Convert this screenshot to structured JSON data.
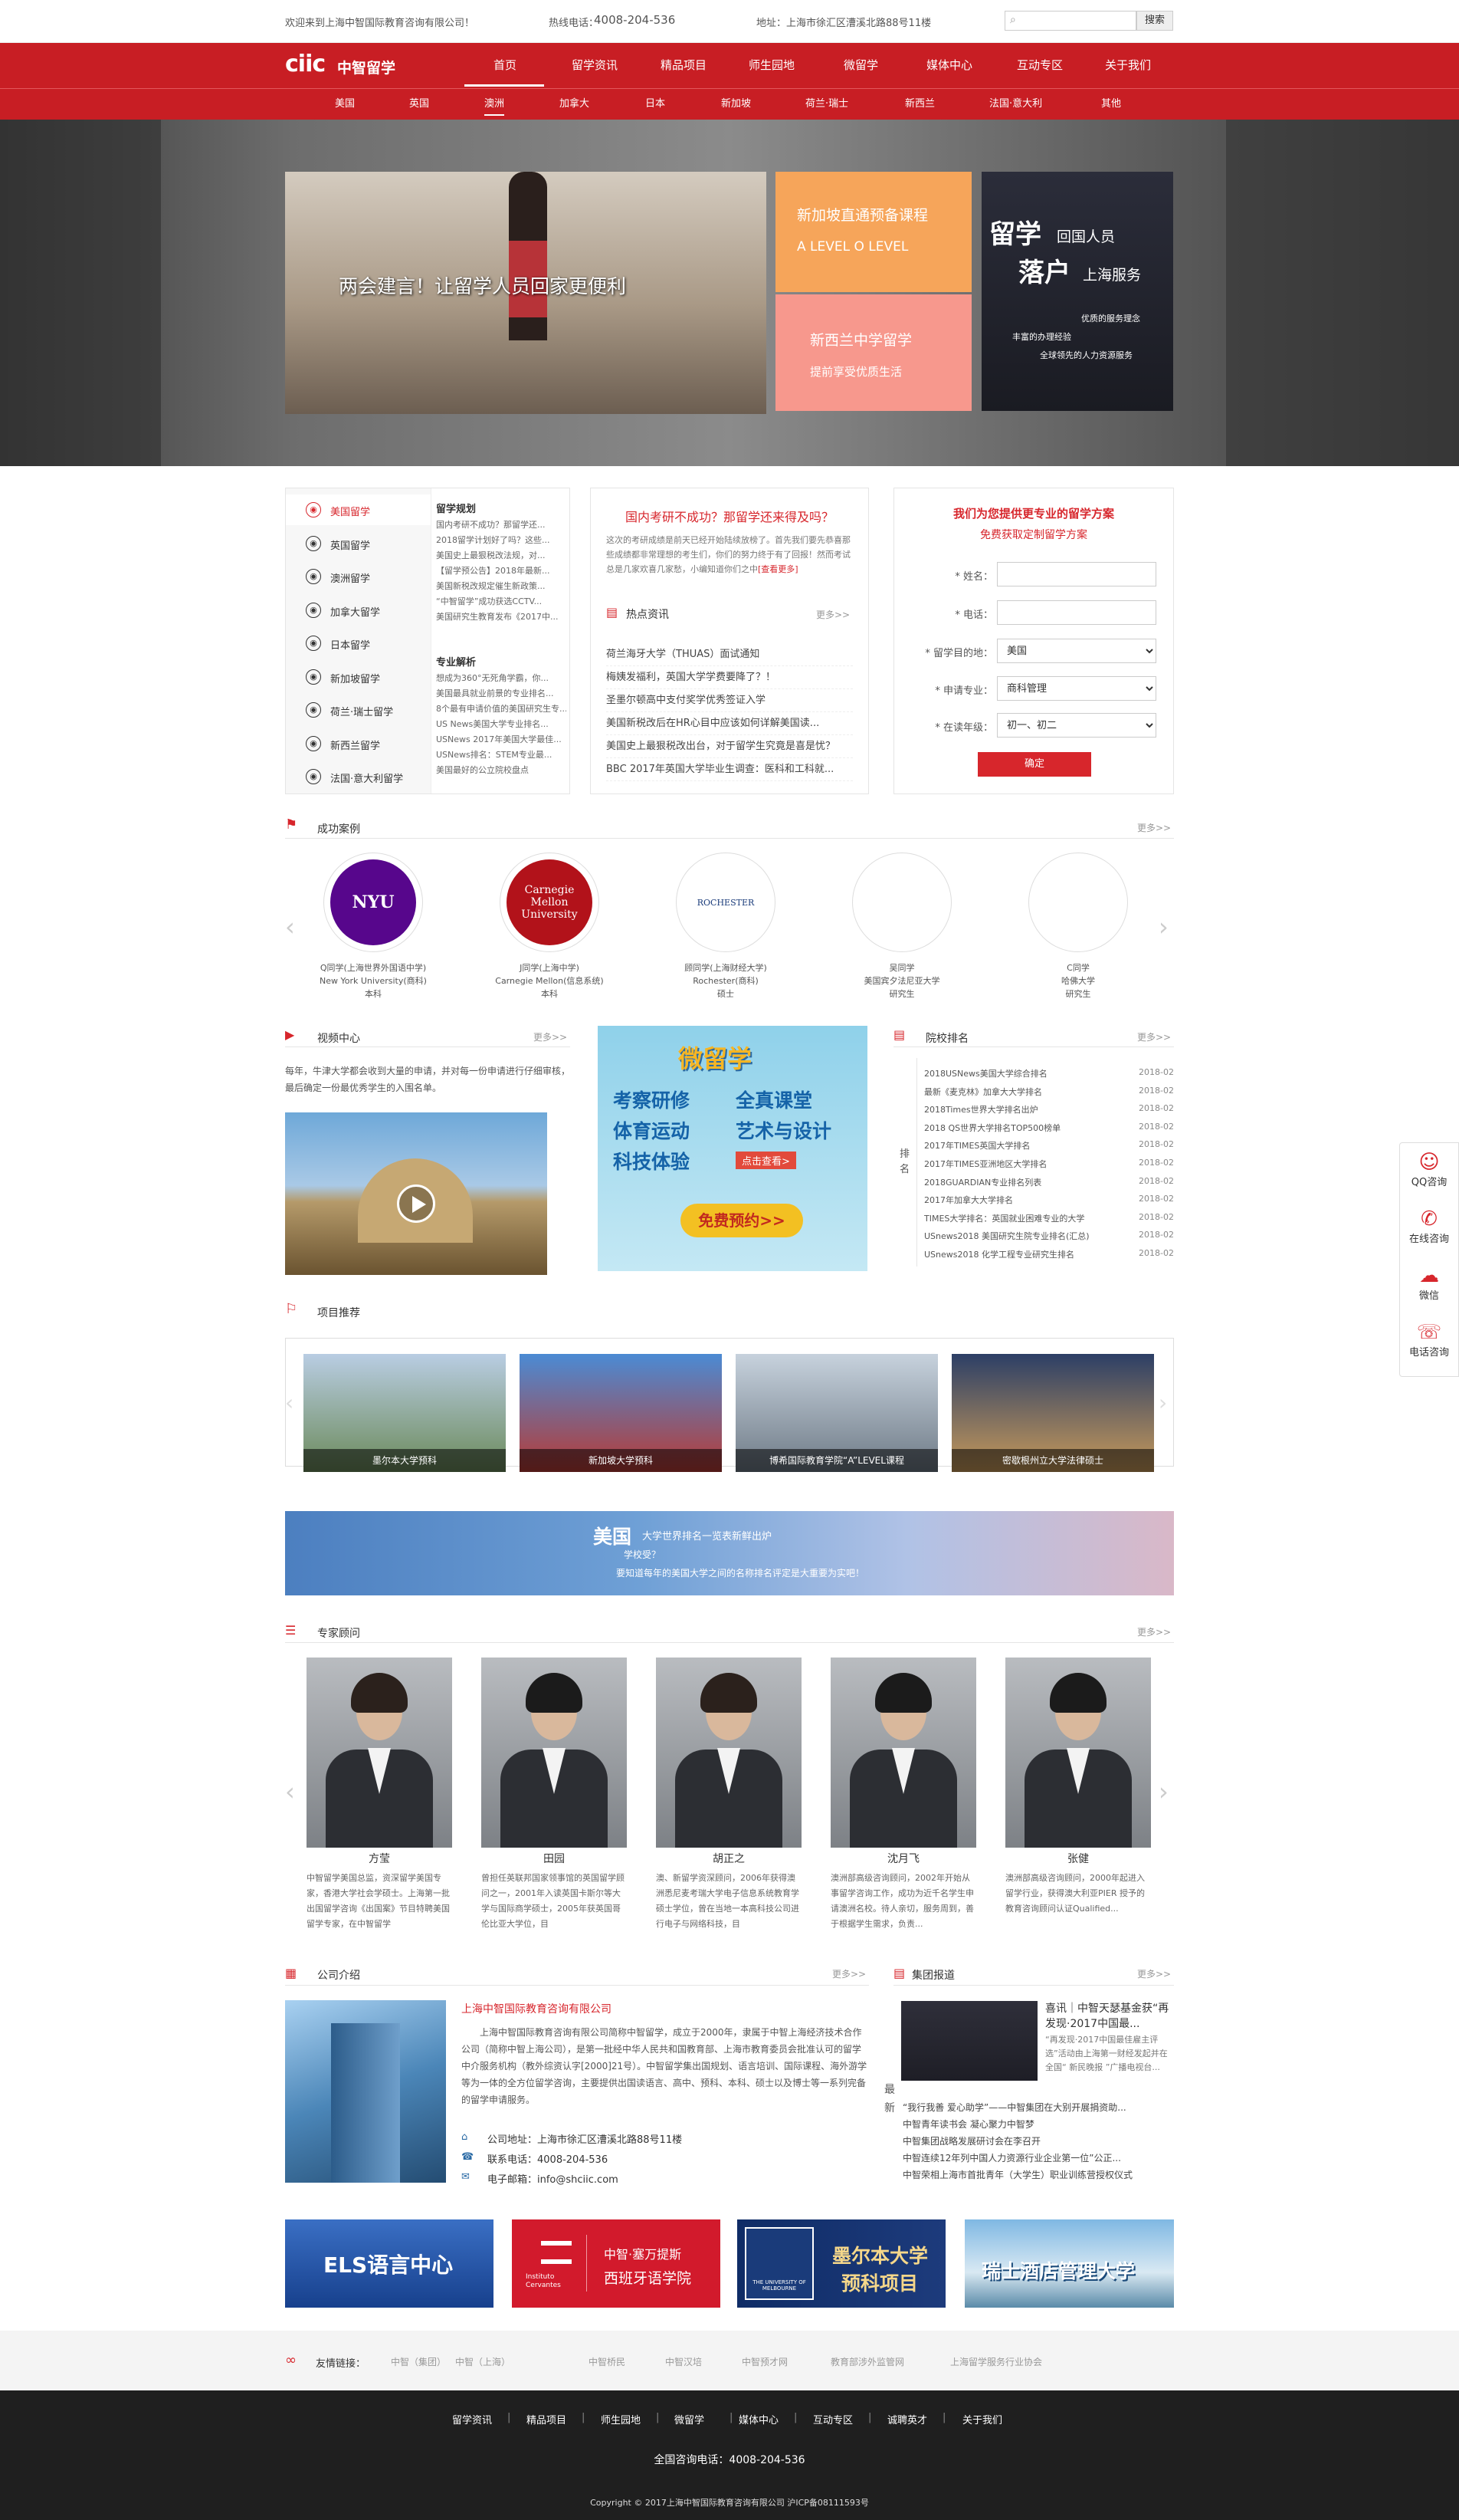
{
  "topbar": {
    "welcome": "欢迎来到上海中智国际教育咨询有限公司！",
    "hotline_label": "热线电话：",
    "hotline": "4008-204-536",
    "address": "地址：上海市徐汇区漕溪北路88号11楼",
    "search_btn": "搜索"
  },
  "brand": {
    "logo": "ciic",
    "logo_cn": "中智留学"
  },
  "nav": [
    "首页",
    "留学资讯",
    "精品项目",
    "师生园地",
    "微留学",
    "媒体中心",
    "互动专区",
    "关于我们"
  ],
  "subnav": [
    "美国",
    "英国",
    "澳洲",
    "加拿大",
    "日本",
    "新加坡",
    "荷兰·瑞士",
    "新西兰",
    "法国·意大利",
    "其他"
  ],
  "hero": {
    "main_caption": "两会建言！让留学人员回家更便利",
    "card1_title": "新加坡直通预备课程",
    "card1_sub": "A LEVEL    O LEVEL",
    "card2_title": "新西兰中学留学",
    "card2_sub": "提前享受优质生活",
    "card3_big1": "留学",
    "card3_small1": "回国人员",
    "card3_big2": "落户",
    "card3_small2": "上海服务",
    "card3_l1": "优质的服务理念",
    "card3_l2": "丰富的办理经验",
    "card3_l3": "全球领先的人力资源服务"
  },
  "country_menu": [
    "美国留学",
    "英国留学",
    "澳洲留学",
    "加拿大留学",
    "日本留学",
    "新加坡留学",
    "荷兰·瑞士留学",
    "新西兰留学",
    "法国·意大利留学"
  ],
  "plan": {
    "title": "留学规划",
    "items": [
      "国内考研不成功？那留学还...",
      "2018留学计划好了吗？这些...",
      "美国史上最狠税改法规，对...",
      "【留学预公告】2018年最新...",
      "美国新税改规定催生新政策...",
      "“中智留学”成功获选CCTV...",
      "美国研究生教育发布《2017中..."
    ]
  },
  "major": {
    "title": "专业解析",
    "items": [
      "想成为360°无死角学霸，你...",
      "美国最具就业前景的专业排名...",
      "8个最有申请价值的美国研究生专...",
      "US News美国大学专业排名...",
      "USNews 2017年美国大学最佳...",
      "USNews排名：STEM专业最...",
      "美国最好的公立院校盘点"
    ]
  },
  "news": {
    "headline": "国内考研不成功？那留学还来得及吗？",
    "summary": "这次的考研成绩是前天已经开始陆续放榜了。首先我们要先恭喜那些成绩都非常理想的考生们，你们的努力终于有了回报！然而考试总是几家欢喜几家愁，小编知道你们之中",
    "read_more": "[查看更多]",
    "section": "热点资讯",
    "more": "更多>>",
    "items": [
      "荷兰海牙大学（THUAS）面试通知",
      "梅姨发福利，英国大学学费要降了？！",
      "圣墨尔顿高中支付奖学优秀签证入学",
      "美国新税改后在HR心目中应该如何详解美国读...",
      "美国史上最狠税改出台，对于留学生究竟是喜是忧？",
      "BBC 2017年英国大学毕业生调查：医科和工科就..."
    ]
  },
  "form": {
    "title": "我们为您提供更专业的留学方案",
    "subtitle": "免费获取定制留学方案",
    "name_label": "* 姓名：",
    "phone_label": "* 电话：",
    "dest_label": "* 留学目的地：",
    "dest_value": "美国",
    "major_label": "* 申请专业：",
    "major_value": "商科管理",
    "grade_label": "* 在读年级：",
    "grade_value": "初一、初二",
    "submit": "确定"
  },
  "cases": {
    "title": "成功案例",
    "more": "更多>>",
    "items": [
      {
        "logo": "NYU",
        "name": "Q同学(上海世界外国语中学)",
        "school": "New York University(商科)",
        "degree": "本科"
      },
      {
        "logo": "Carnegie Mellon University",
        "name": "J同学(上海中学)",
        "school": "Carnegie Mellon(信息系统)",
        "degree": "本科"
      },
      {
        "logo": "ROCHESTER",
        "name": "顾同学(上海财经大学)",
        "school": "Rochester(商科)",
        "degree": "硕士"
      },
      {
        "logo": "",
        "name": "吴同学",
        "school": "美国宾夕法尼亚大学",
        "degree": "研究生"
      },
      {
        "logo": "",
        "name": "C同学",
        "school": "哈佛大学",
        "degree": "研究生"
      }
    ]
  },
  "video": {
    "title": "视频中心",
    "more": "更多>>",
    "desc": "每年，牛津大学都会收到大量的申请，并对每一份申请进行仔细审核，最后确定一份最优秀学生的入围名单。"
  },
  "micro": {
    "title": "微留学",
    "row1a": "考察研修",
    "row1b": "全真课堂",
    "row2a": "体育运动",
    "row2b": "艺术与设计",
    "row3": "科技体验",
    "row3tag": "点击查看>",
    "cta": "免费预约>>"
  },
  "ranking": {
    "title": "院校排名",
    "more": "更多>>",
    "side": "排名",
    "items": [
      {
        "t": "2018USNews美国大学综合排名",
        "d": "2018-02"
      },
      {
        "t": "最新《麦克林》加拿大大学排名",
        "d": "2018-02"
      },
      {
        "t": "2018Times世界大学排名出炉",
        "d": "2018-02"
      },
      {
        "t": "2018 QS世界大学排名TOP500榜单",
        "d": "2018-02"
      },
      {
        "t": "2017年TIMES英国大学排名",
        "d": "2018-02"
      },
      {
        "t": "2017年TIMES亚洲地区大学排名",
        "d": "2018-02"
      },
      {
        "t": "2018GUARDIAN专业排名列表",
        "d": "2018-02"
      },
      {
        "t": "2017年加拿大大学排名",
        "d": "2018-02"
      },
      {
        "t": "TIMES大学排名：英国就业困难专业的大学",
        "d": "2018-02"
      },
      {
        "t": "USnews2018 美国研究生院专业排名(汇总)",
        "d": "2018-02"
      },
      {
        "t": "USnews2018 化学工程专业研究生排名",
        "d": "2018-02"
      }
    ]
  },
  "projects": {
    "title": "项目推荐",
    "items": [
      "墨尔本大学预科",
      "新加坡大学预科",
      "博希国际教育学院“A”LEVEL课程",
      "密歇根州立大学法律硕士"
    ]
  },
  "promo": {
    "big": "美国",
    "l1": "大学世界排名一览表新鲜出炉",
    "l2": "学校受？",
    "l3": "要知道每年的美国大学之间的名称排名评定是大重要为实吧！"
  },
  "experts": {
    "title": "专家顾问",
    "more": "更多>>",
    "items": [
      {
        "name": "方莹",
        "desc": "中智留学美国总监，资深留学美国专家，香港大学社会学硕士。上海第一批出国留学咨询《出国案》节目特聘美国留学专家，在中智留学"
      },
      {
        "name": "田园",
        "desc": "曾担任英联邦国家领事馆的英国留学顾问之一，2001年入读英国卡斯尔等大学与国际商学硕士，2005年获英国哥伦比亚大学位，目"
      },
      {
        "name": "胡正之",
        "desc": "澳、新留学资深顾问，2006年获得澳洲悉尼麦考瑞大学电子信息系统教育学硕士学位，曾在当地一本高科技公司进行电子与网络科技，目"
      },
      {
        "name": "沈月飞",
        "desc": "澳洲部高级咨询顾问，2002年开始从事留学咨询工作，成功为近千名学生申请澳洲名校。待人亲切，服务周到，善于根据学生需求，负责..."
      },
      {
        "name": "张健",
        "desc": "澳洲部高级咨询顾问，2000年起进入留学行业，获得澳大利亚PIER 授予的教育咨询顾问认证Qualified..."
      }
    ]
  },
  "about": {
    "title": "公司介绍",
    "more": "更多>>",
    "company": "上海中智国际教育咨询有限公司",
    "text": "上海中智国际教育咨询有限公司简称中智留学，成立于2000年，隶属于中智上海经济技术合作公司（简称中智上海公司），是第一批经中华人民共和国教育部、上海市教育委员会批准认可的留学中介服务机构（教外综资认字[2000]21号）。中智留学集出国规划、语言培训、国际课程、海外游学等为一体的全方位留学咨询，主要提供出国读语言、高中、预科、本科、硕士以及博士等一系列完备的留学申请服务。",
    "addr": "公司地址：上海市徐汇区漕溪北路88号11楼",
    "phone": "联系电话：4008-204-536",
    "email": "电子邮箱：info@shciic.com"
  },
  "group": {
    "title": "集团报道",
    "more": "更多>>",
    "side": "最新",
    "headline": "喜讯｜中智天瑟基金获“再发现·2017中国最...",
    "summary": "“再发现·2017中国最佳雇主评选”活动由上海第一财经发起并在全国“ 新民晚报 ”广播电视台...",
    "items": [
      "“我行我善 爱心助学”——中智集团在大别开展捐资助...",
      "中智青年读书会 凝心聚力中智梦",
      "中智集团战略发展研讨会在李召开",
      "中智连续12年列中国人力资源行业企业第一位”公正...",
      "中智荣相上海市首批青年（大学生）职业训练营授权仪式"
    ]
  },
  "banners": {
    "b1": "ELS语言中心",
    "b2a": "中智·塞万提斯",
    "b2b": "西班牙语学院",
    "b2logo": "Instituto Cervantes",
    "b3a": "墨尔本大学",
    "b3b": "预科项目",
    "b3logo": "THE UNIVERSITY OF MELBOURNE",
    "b4": "瑞士酒店管理大学"
  },
  "links": {
    "label": "友情链接：",
    "items": [
      "中智（集团）",
      "中智（上海）",
      "中智桥民",
      "中智汉培",
      "中智预才网",
      "教育部涉外监管网",
      "上海留学服务行业协会"
    ]
  },
  "footer": {
    "nav": [
      "留学资讯",
      "精品项目",
      "师生园地",
      "微留学",
      "媒体中心",
      "互动专区",
      "诚聘英才",
      "关于我们"
    ],
    "hotline": "全国咨询电话：4008-204-536",
    "copyright": "Copyright © 2017上海中智国际教育咨询有限公司 沪ICP备08111593号"
  },
  "float": {
    "qq": "QQ咨询",
    "online": "在线咨询",
    "wechat": "微信",
    "phone": "电话咨询"
  },
  "colors": {
    "brand_red": "#c81e24",
    "accent_red": "#d7262c"
  }
}
